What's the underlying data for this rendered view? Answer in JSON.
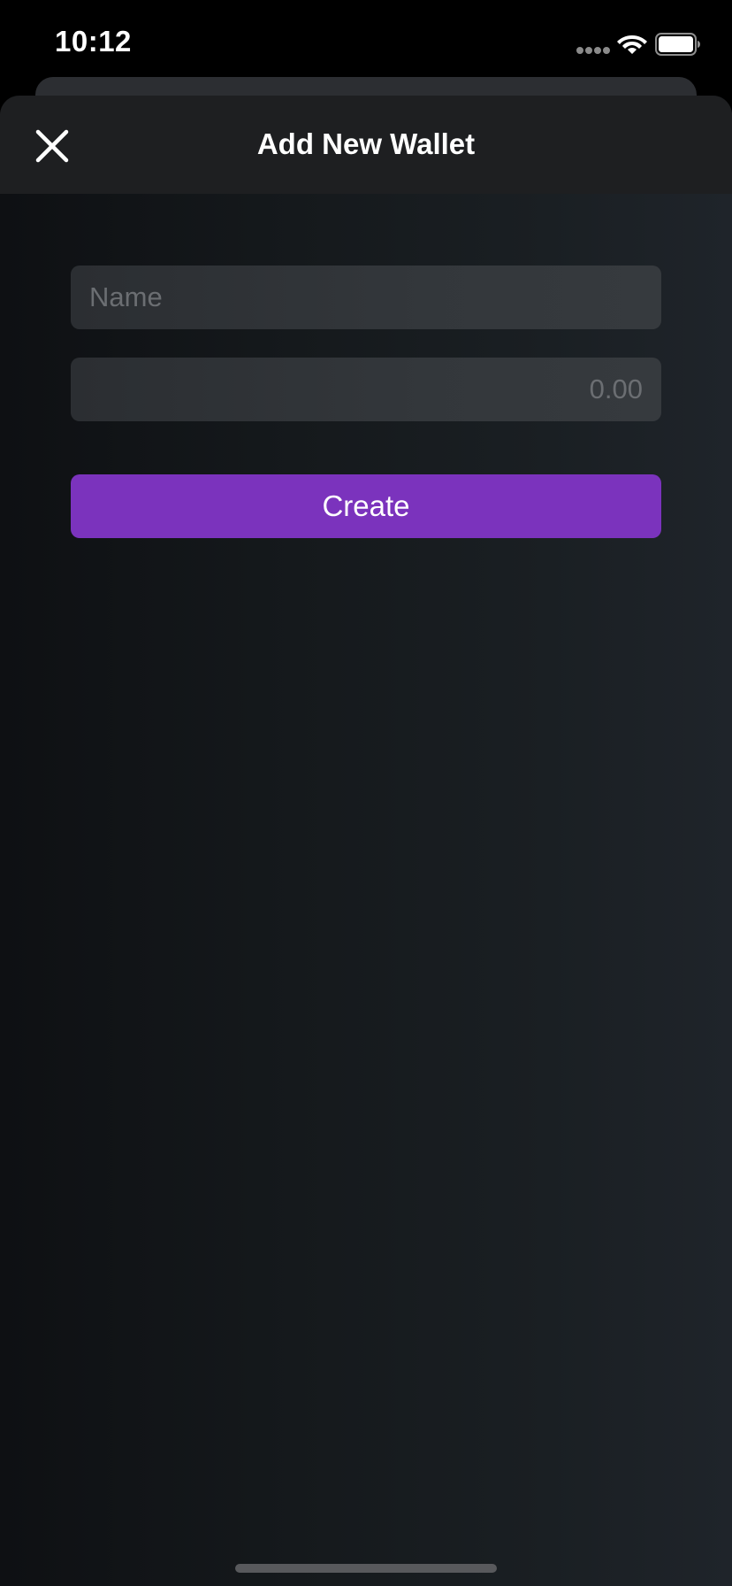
{
  "status_bar": {
    "time": "10:12",
    "signal_icon": "cellular-dots-icon",
    "wifi_icon": "wifi-icon",
    "battery_icon": "battery-full-icon"
  },
  "nav": {
    "title": "Add New Wallet",
    "close_icon": "close-icon"
  },
  "form": {
    "name_field": {
      "value": "",
      "placeholder": "Name"
    },
    "amount_field": {
      "value": "",
      "placeholder": "0.00"
    },
    "create_label": "Create"
  },
  "colors": {
    "accent": "#7b33bd",
    "nav_background": "#1e1f21",
    "field_background": "#33373b",
    "placeholder_text": "#6b6e72"
  }
}
